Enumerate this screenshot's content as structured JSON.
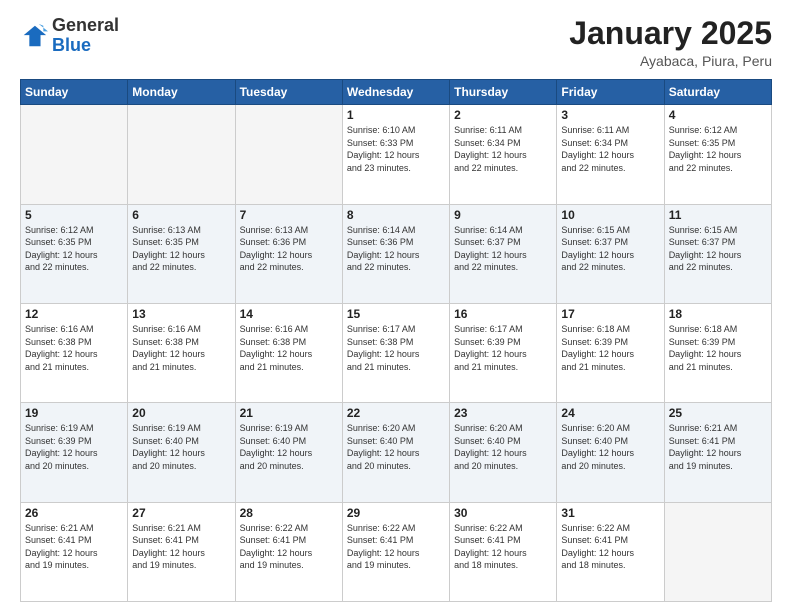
{
  "header": {
    "logo_general": "General",
    "logo_blue": "Blue",
    "title": "January 2025",
    "subtitle": "Ayabaca, Piura, Peru"
  },
  "weekdays": [
    "Sunday",
    "Monday",
    "Tuesday",
    "Wednesday",
    "Thursday",
    "Friday",
    "Saturday"
  ],
  "weeks": [
    [
      {
        "day": "",
        "info": ""
      },
      {
        "day": "",
        "info": ""
      },
      {
        "day": "",
        "info": ""
      },
      {
        "day": "1",
        "info": "Sunrise: 6:10 AM\nSunset: 6:33 PM\nDaylight: 12 hours\nand 23 minutes."
      },
      {
        "day": "2",
        "info": "Sunrise: 6:11 AM\nSunset: 6:34 PM\nDaylight: 12 hours\nand 22 minutes."
      },
      {
        "day": "3",
        "info": "Sunrise: 6:11 AM\nSunset: 6:34 PM\nDaylight: 12 hours\nand 22 minutes."
      },
      {
        "day": "4",
        "info": "Sunrise: 6:12 AM\nSunset: 6:35 PM\nDaylight: 12 hours\nand 22 minutes."
      }
    ],
    [
      {
        "day": "5",
        "info": "Sunrise: 6:12 AM\nSunset: 6:35 PM\nDaylight: 12 hours\nand 22 minutes."
      },
      {
        "day": "6",
        "info": "Sunrise: 6:13 AM\nSunset: 6:35 PM\nDaylight: 12 hours\nand 22 minutes."
      },
      {
        "day": "7",
        "info": "Sunrise: 6:13 AM\nSunset: 6:36 PM\nDaylight: 12 hours\nand 22 minutes."
      },
      {
        "day": "8",
        "info": "Sunrise: 6:14 AM\nSunset: 6:36 PM\nDaylight: 12 hours\nand 22 minutes."
      },
      {
        "day": "9",
        "info": "Sunrise: 6:14 AM\nSunset: 6:37 PM\nDaylight: 12 hours\nand 22 minutes."
      },
      {
        "day": "10",
        "info": "Sunrise: 6:15 AM\nSunset: 6:37 PM\nDaylight: 12 hours\nand 22 minutes."
      },
      {
        "day": "11",
        "info": "Sunrise: 6:15 AM\nSunset: 6:37 PM\nDaylight: 12 hours\nand 22 minutes."
      }
    ],
    [
      {
        "day": "12",
        "info": "Sunrise: 6:16 AM\nSunset: 6:38 PM\nDaylight: 12 hours\nand 21 minutes."
      },
      {
        "day": "13",
        "info": "Sunrise: 6:16 AM\nSunset: 6:38 PM\nDaylight: 12 hours\nand 21 minutes."
      },
      {
        "day": "14",
        "info": "Sunrise: 6:16 AM\nSunset: 6:38 PM\nDaylight: 12 hours\nand 21 minutes."
      },
      {
        "day": "15",
        "info": "Sunrise: 6:17 AM\nSunset: 6:38 PM\nDaylight: 12 hours\nand 21 minutes."
      },
      {
        "day": "16",
        "info": "Sunrise: 6:17 AM\nSunset: 6:39 PM\nDaylight: 12 hours\nand 21 minutes."
      },
      {
        "day": "17",
        "info": "Sunrise: 6:18 AM\nSunset: 6:39 PM\nDaylight: 12 hours\nand 21 minutes."
      },
      {
        "day": "18",
        "info": "Sunrise: 6:18 AM\nSunset: 6:39 PM\nDaylight: 12 hours\nand 21 minutes."
      }
    ],
    [
      {
        "day": "19",
        "info": "Sunrise: 6:19 AM\nSunset: 6:39 PM\nDaylight: 12 hours\nand 20 minutes."
      },
      {
        "day": "20",
        "info": "Sunrise: 6:19 AM\nSunset: 6:40 PM\nDaylight: 12 hours\nand 20 minutes."
      },
      {
        "day": "21",
        "info": "Sunrise: 6:19 AM\nSunset: 6:40 PM\nDaylight: 12 hours\nand 20 minutes."
      },
      {
        "day": "22",
        "info": "Sunrise: 6:20 AM\nSunset: 6:40 PM\nDaylight: 12 hours\nand 20 minutes."
      },
      {
        "day": "23",
        "info": "Sunrise: 6:20 AM\nSunset: 6:40 PM\nDaylight: 12 hours\nand 20 minutes."
      },
      {
        "day": "24",
        "info": "Sunrise: 6:20 AM\nSunset: 6:40 PM\nDaylight: 12 hours\nand 20 minutes."
      },
      {
        "day": "25",
        "info": "Sunrise: 6:21 AM\nSunset: 6:41 PM\nDaylight: 12 hours\nand 19 minutes."
      }
    ],
    [
      {
        "day": "26",
        "info": "Sunrise: 6:21 AM\nSunset: 6:41 PM\nDaylight: 12 hours\nand 19 minutes."
      },
      {
        "day": "27",
        "info": "Sunrise: 6:21 AM\nSunset: 6:41 PM\nDaylight: 12 hours\nand 19 minutes."
      },
      {
        "day": "28",
        "info": "Sunrise: 6:22 AM\nSunset: 6:41 PM\nDaylight: 12 hours\nand 19 minutes."
      },
      {
        "day": "29",
        "info": "Sunrise: 6:22 AM\nSunset: 6:41 PM\nDaylight: 12 hours\nand 19 minutes."
      },
      {
        "day": "30",
        "info": "Sunrise: 6:22 AM\nSunset: 6:41 PM\nDaylight: 12 hours\nand 18 minutes."
      },
      {
        "day": "31",
        "info": "Sunrise: 6:22 AM\nSunset: 6:41 PM\nDaylight: 12 hours\nand 18 minutes."
      },
      {
        "day": "",
        "info": ""
      }
    ]
  ]
}
